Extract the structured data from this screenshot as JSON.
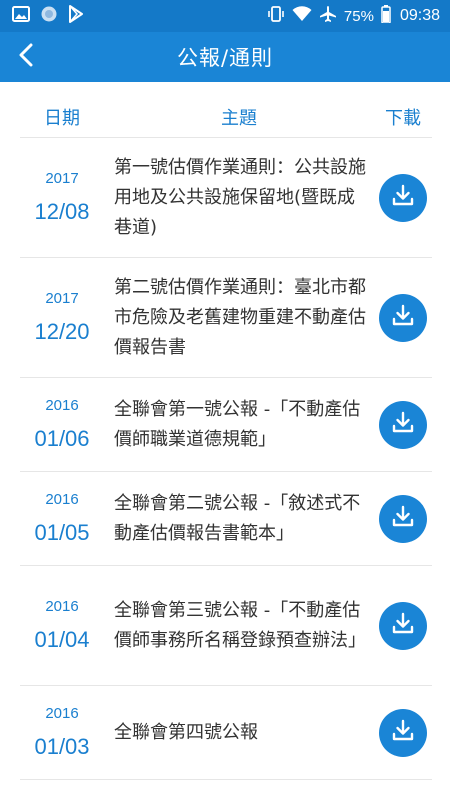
{
  "status_bar": {
    "battery_percent": "75%",
    "time": "09:38",
    "icons": [
      "image-icon",
      "sync-icon",
      "play-store-icon",
      "vibrate-icon",
      "wifi-icon",
      "airplane-icon",
      "battery-icon"
    ]
  },
  "app_bar": {
    "title": "公報/通則",
    "back_icon": "back-arrow-icon"
  },
  "table_header": {
    "date": "日期",
    "subject": "主題",
    "download": "下載"
  },
  "colors": {
    "status_bar": "#1479c8",
    "app_bar": "#1a85d6",
    "accent": "#1a7fcf",
    "text": "#333333"
  },
  "rows": [
    {
      "year": "2017",
      "month_day": "12/08",
      "subject": "第一號估價作業通則：公共設施用地及公共設施保留地(暨既成巷道)",
      "icon": "download-icon"
    },
    {
      "year": "2017",
      "month_day": "12/20",
      "subject": "第二號估價作業通則：臺北市都市危險及老舊建物重建不動產估價報告書",
      "icon": "download-icon"
    },
    {
      "year": "2016",
      "month_day": "01/06",
      "subject": "全聯會第一號公報 -「不動產估價師職業道德規範」",
      "icon": "download-icon"
    },
    {
      "year": "2016",
      "month_day": "01/05",
      "subject": "全聯會第二號公報 -「敘述式不動產估價報告書範本」",
      "icon": "download-icon"
    },
    {
      "year": "2016",
      "month_day": "01/04",
      "subject": "全聯會第三號公報 -「不動產估價師事務所名稱登錄預查辦法」",
      "icon": "download-icon"
    },
    {
      "year": "2016",
      "month_day": "01/03",
      "subject": "全聯會第四號公報",
      "icon": "download-icon"
    }
  ]
}
